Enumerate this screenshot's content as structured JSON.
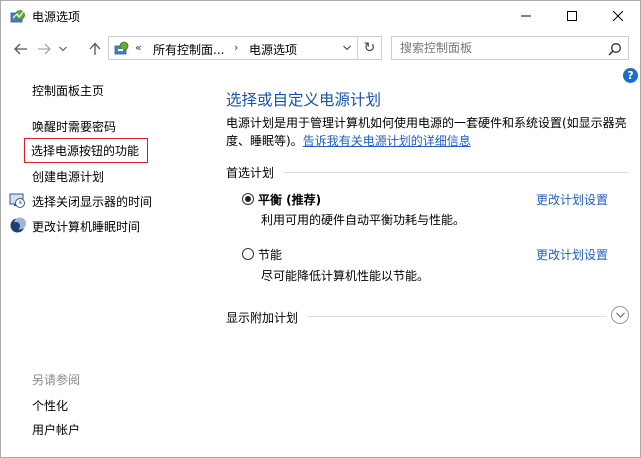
{
  "window": {
    "title": "电源选项",
    "buttons": {
      "minimize": "—",
      "maximize": "☐",
      "close": "✕"
    }
  },
  "address": {
    "back_icon": "arrow-left-icon",
    "forward_icon": "arrow-right-icon",
    "recent_icon": "chevron-down-icon",
    "up_icon": "arrow-up-icon",
    "overflow": "«",
    "crumbs": [
      "所有控制面...",
      "电源选项"
    ],
    "separator": "›",
    "refresh": "↻",
    "search_placeholder": "搜索控制面板"
  },
  "help": "?",
  "sidebar": {
    "home": "控制面板主页",
    "items": [
      {
        "label": "唤醒时需要密码",
        "icon": ""
      },
      {
        "label": "选择电源按钮的功能",
        "icon": ""
      },
      {
        "label": "创建电源计划",
        "icon": ""
      },
      {
        "label": "选择关闭显示器的时间",
        "icon": "monitor-clock-icon"
      },
      {
        "label": "更改计算机睡眠时间",
        "icon": "moon-icon"
      }
    ],
    "see_also_title": "另请参阅",
    "see_also": [
      "个性化",
      "用户帐户"
    ]
  },
  "main": {
    "title": "选择或自定义电源计划",
    "desc_text": "电源计划是用于管理计算机如何使用电源的一套硬件和系统设置(如显示器亮度、睡眠等)。",
    "desc_link": "告诉我有关电源计划的详细信息",
    "preferred_heading": "首选计划",
    "plans": [
      {
        "name": "平衡 (推荐)",
        "desc": "利用可用的硬件自动平衡功耗与性能。",
        "change_link": "更改计划设置",
        "selected": true
      },
      {
        "name": "节能",
        "desc": "尽可能降低计算机性能以节能。",
        "change_link": "更改计划设置",
        "selected": false
      }
    ],
    "additional_heading": "显示附加计划"
  }
}
